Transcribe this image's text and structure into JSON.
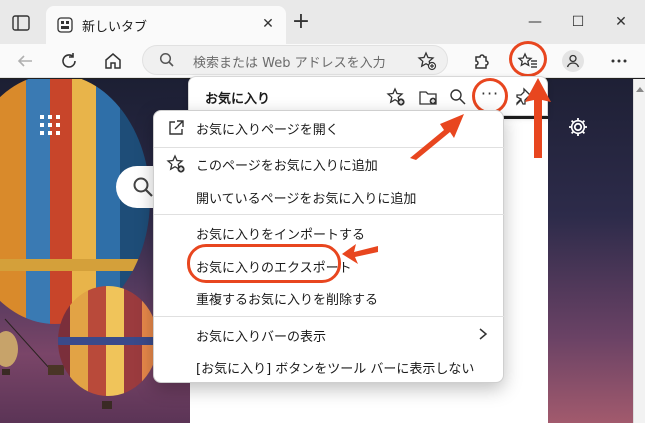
{
  "tab": {
    "title": "新しいタブ"
  },
  "toolbar": {
    "address_placeholder": "検索または Web アドレスを入力"
  },
  "favorites_panel": {
    "title": "お気に入り"
  },
  "menu": {
    "items": [
      {
        "label": "お気に入りページを開く",
        "icon": "external-link-icon"
      },
      {
        "label": "このページをお気に入りに追加",
        "icon": "star-add-icon"
      },
      {
        "label": "開いているページをお気に入りに追加",
        "icon": ""
      },
      {
        "label": "お気に入りをインポートする",
        "icon": ""
      },
      {
        "label": "お気に入りのエクスポート",
        "icon": ""
      },
      {
        "label": "重複するお気に入りを削除する",
        "icon": ""
      },
      {
        "label": "お気に入りバーの表示",
        "icon": "chevron-right-icon"
      },
      {
        "label": "[お気に入り] ボタンをツール バーに表示しない",
        "icon": ""
      }
    ]
  },
  "colors": {
    "accent": "#e8461f",
    "highlight_ring": "#e8461f"
  }
}
